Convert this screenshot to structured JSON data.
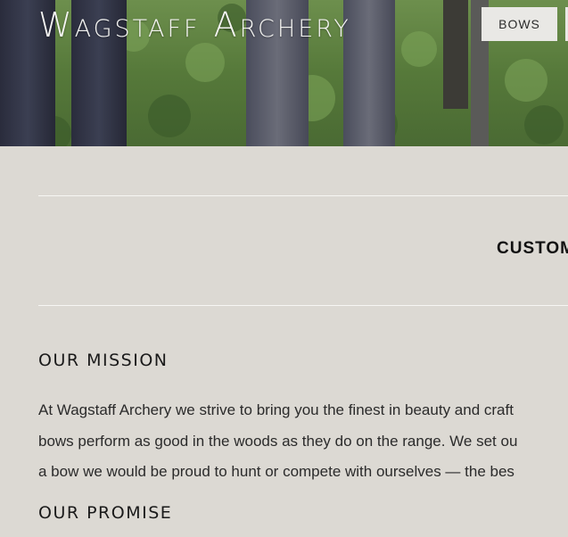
{
  "header": {
    "site_title": "Wagstaff Archery",
    "nav": {
      "bows_label": "BOWS"
    }
  },
  "main": {
    "banner_heading": "CUSTOM",
    "mission": {
      "heading": "OUR MISSION",
      "lines": [
        "At Wagstaff Archery we strive to bring you the finest in beauty and craft",
        "bows perform as good in the woods as they do on the range. We set ou",
        "a bow we would be proud to hunt or compete with ourselves — the bes"
      ]
    },
    "promise": {
      "heading": "OUR PROMISE"
    }
  },
  "colors": {
    "page_background": "#dcd9d3",
    "nav_button_background": "#e9e8e5",
    "rule": "#f7f6f3",
    "title_text": "#f4f4f2"
  },
  "images": {
    "hero": "forest-trees-photo"
  }
}
